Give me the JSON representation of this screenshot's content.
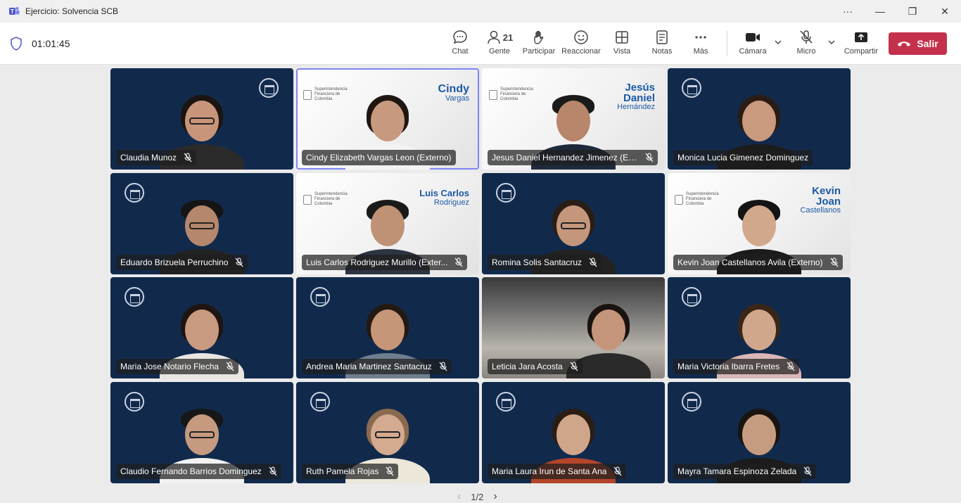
{
  "window": {
    "title": "Ejercicio: Solvencia SCB",
    "controls": [
      "···",
      "—",
      "❐",
      "✕"
    ]
  },
  "toolbar": {
    "timer": "01:01:45",
    "buttons": [
      {
        "label": "Chat",
        "icon": "chat-icon"
      },
      {
        "label": "Gente",
        "icon": "people-icon",
        "badge": "21"
      },
      {
        "label": "Participar",
        "icon": "raise-hand-icon"
      },
      {
        "label": "Reaccionar",
        "icon": "smiley-icon"
      },
      {
        "label": "Vista",
        "icon": "grid-view-icon"
      },
      {
        "label": "Notas",
        "icon": "notes-icon"
      },
      {
        "label": "Más",
        "icon": "more-icon"
      },
      {
        "label": "Cámara",
        "icon": "camera-icon"
      },
      {
        "label": "Micro",
        "icon": "mic-off-icon"
      },
      {
        "label": "Compartir",
        "icon": "share-icon"
      }
    ],
    "leave": {
      "label": "Salir",
      "color": "#c4314b"
    }
  },
  "colors": {
    "tile_bg": "#112a4c",
    "active_outline": "#7f85f5",
    "brand_blue": "#1c5aa6"
  },
  "tiles": [
    {
      "name": "Claudia Munoz"
    },
    {
      "name": "Cindy Elizabeth Vargas Leon (Externo)",
      "overlay_first": "Cindy",
      "overlay_last": "Vargas",
      "brand": "Superintendencia Financiera de Colombia"
    },
    {
      "name": "Jesus Daniel Hernandez Jimenez (Ex...",
      "overlay_first": "Jesús Daniel",
      "overlay_last": "Hernández",
      "brand": "Superintendencia Financiera de Colombia"
    },
    {
      "name": "Monica Lucia Gimenez Dominguez"
    },
    {
      "name": "Eduardo Brizuela Perruchino"
    },
    {
      "name": "Luis Carlos Rodriguez Murillo (Exter...",
      "overlay_first": "Luis Carlos",
      "overlay_last": "Rodriguez",
      "brand": "Superintendencia Financiera de Colombia"
    },
    {
      "name": "Romina Solis Santacruz"
    },
    {
      "name": "Kevin Joan Castellanos Avila (Externo)",
      "overlay_first": "Kevin Joan",
      "overlay_last": "Castellanos",
      "brand": "Superintendencia Financiera de Colombia"
    },
    {
      "name": "Maria Jose Notario Flecha"
    },
    {
      "name": "Andrea Maria Martinez Santacruz"
    },
    {
      "name": "Leticia Jara Acosta"
    },
    {
      "name": "Maria Victoria Ibarra Fretes"
    },
    {
      "name": "Claudio Fernando Barrios Dominguez"
    },
    {
      "name": "Ruth Pamela Rojas"
    },
    {
      "name": "Maria Laura Irun de Santa Ana"
    },
    {
      "name": "Mayra Tamara Espinoza Zelada"
    }
  ],
  "pager": {
    "text": "1/2",
    "prev": "‹",
    "next": "›"
  }
}
